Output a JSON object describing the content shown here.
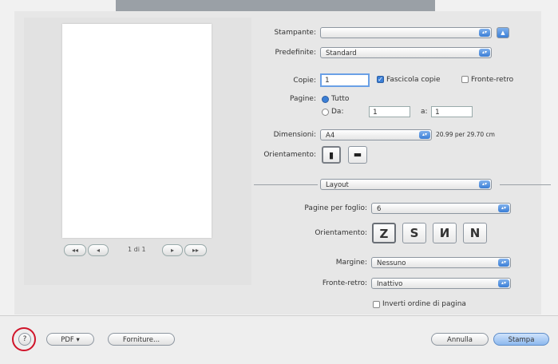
{
  "printer": {
    "printer_label": "Stampante:",
    "printer_value": "",
    "presets_label": "Predefinite:",
    "presets_value": "Standard"
  },
  "copies": {
    "label": "Copie:",
    "value": "1",
    "collate_label": "Fascicola copie",
    "collate_checked": true,
    "duplex_label": "Fronte-retro",
    "duplex_checked": false
  },
  "pages": {
    "label": "Pagine:",
    "all_label": "Tutto",
    "from_label": "Da:",
    "from_value": "1",
    "to_label": "a:",
    "to_value": "1"
  },
  "paper": {
    "size_label": "Dimensioni:",
    "size_value": "A4",
    "size_dims": "20.99 per 29.70 cm",
    "orientation_label": "Orientamento:"
  },
  "section": {
    "value": "Layout"
  },
  "layout": {
    "pages_per_sheet_label": "Pagine per foglio:",
    "pages_per_sheet_value": "6",
    "orientation_label": "Orientamento:",
    "layout_icons": [
      "Z",
      "S",
      "И",
      "N"
    ],
    "border_label": "Margine:",
    "border_value": "Nessuno",
    "two_sided_label": "Fronte-retro:",
    "two_sided_value": "Inattivo",
    "reverse_label": "Inverti ordine di pagina",
    "reverse_checked": false
  },
  "preview": {
    "pager": "1 di 1",
    "first_label": "◂◂",
    "prev_label": "◂",
    "next_label": "▸",
    "last_label": "▸▸"
  },
  "footer": {
    "help_label": "?",
    "pdf_label": "PDF ▾",
    "supplies_label": "Forniture...",
    "cancel_label": "Annulla",
    "print_label": "Stampa"
  },
  "colors": {
    "accent": "#3b7fd6",
    "highlight_ring": "#d0142a"
  }
}
